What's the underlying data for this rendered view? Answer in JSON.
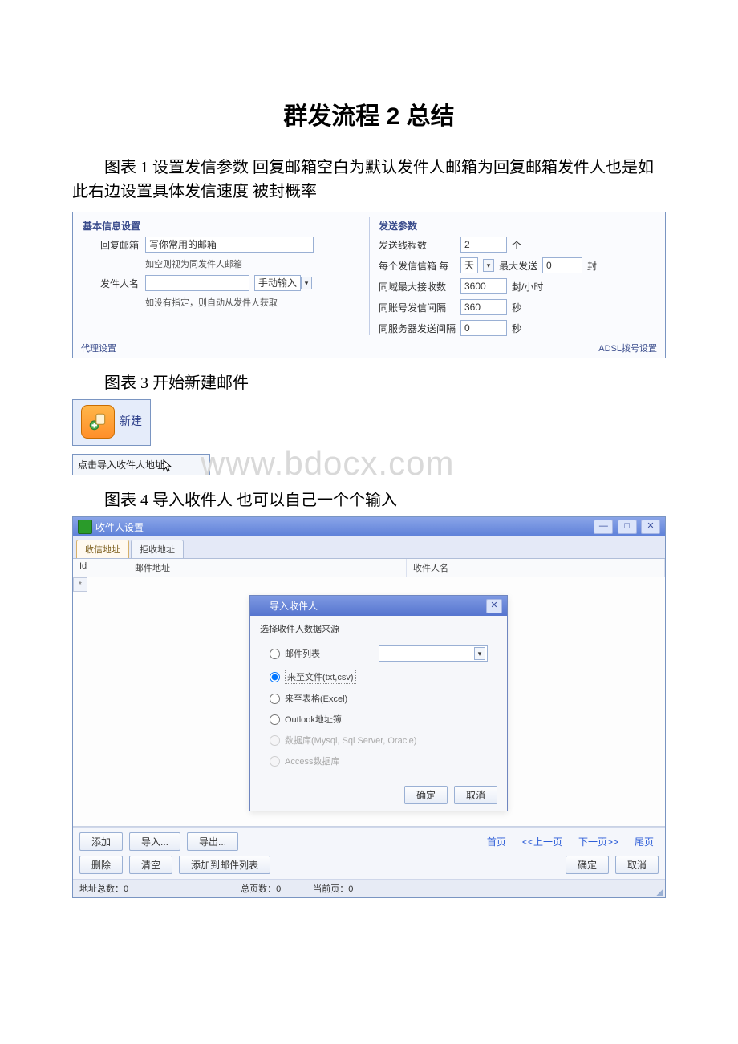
{
  "doc": {
    "title": "群发流程 2 总结",
    "para1": "图表 1 设置发信参数 回复邮箱空白为默认发件人邮箱为回复邮箱发件人也是如此右边设置具体发信速度 被封概率",
    "cap3": "图表 3 开始新建邮件",
    "cap4": "图表 4 导入收件人 也可以自己一个个输入",
    "import_strip": "点击导入收件人地址",
    "watermark": "www.bdocx.com"
  },
  "fig1": {
    "left": {
      "legend": "基本信息设置",
      "reply_label": "回复邮箱",
      "reply_value": "写你常用的邮箱",
      "reply_hint": "如空则视为同发件人邮箱",
      "sender_label": "发件人名",
      "sender_value": "",
      "sender_mode": "手动输入",
      "sender_hint": "如没有指定，则自动从发件人获取"
    },
    "right": {
      "legend": "发送参数",
      "threads_label": "发送线程数",
      "threads_value": "2",
      "threads_unit": "个",
      "perbox_label": "每个发信信箱 每",
      "perbox_select": "天",
      "perbox_max_label": "最大发送",
      "perbox_max_value": "0",
      "perbox_unit": "封",
      "domain_label": "同域最大接收数",
      "domain_value": "3600",
      "domain_unit": "封/小时",
      "acct_label": "同账号发信间隔",
      "acct_value": "360",
      "acct_unit": "秒",
      "server_label": "同服务器发送间隔",
      "server_value": "0",
      "server_unit": "秒"
    },
    "footer_left": "代理设置",
    "footer_right": "ADSL拨号设置"
  },
  "fig3": {
    "label": "新建"
  },
  "fig4": {
    "title": "收件人设置",
    "tab_active": "收信地址",
    "tab_other": "拒收地址",
    "col_id": "Id",
    "col_addr": "邮件地址",
    "col_name": "收件人名",
    "modal": {
      "title": "导入收件人",
      "prompt": "选择收件人数据来源",
      "opt_list": "邮件列表",
      "opt_file": "来至文件(txt,csv)",
      "opt_excel": "来至表格(Excel)",
      "opt_outlook": "Outlook地址簿",
      "opt_db": "数据库(Mysql, Sql Server, Oracle)",
      "opt_access": "Access数据库",
      "ok": "确定",
      "cancel": "取消"
    },
    "buttons": {
      "add": "添加",
      "import": "导入...",
      "export": "导出...",
      "delete": "删除",
      "clear": "清空",
      "tolist": "添加到邮件列表",
      "first": "首页",
      "prev": "<<上一页",
      "next": "下一页>>",
      "last": "尾页",
      "ok": "确定",
      "cancel": "取消"
    },
    "status": {
      "total_label": "地址总数：",
      "total_value": "0",
      "pages_label": "总页数：",
      "pages_value": "0",
      "cur_label": "当前页：",
      "cur_value": "0"
    }
  }
}
